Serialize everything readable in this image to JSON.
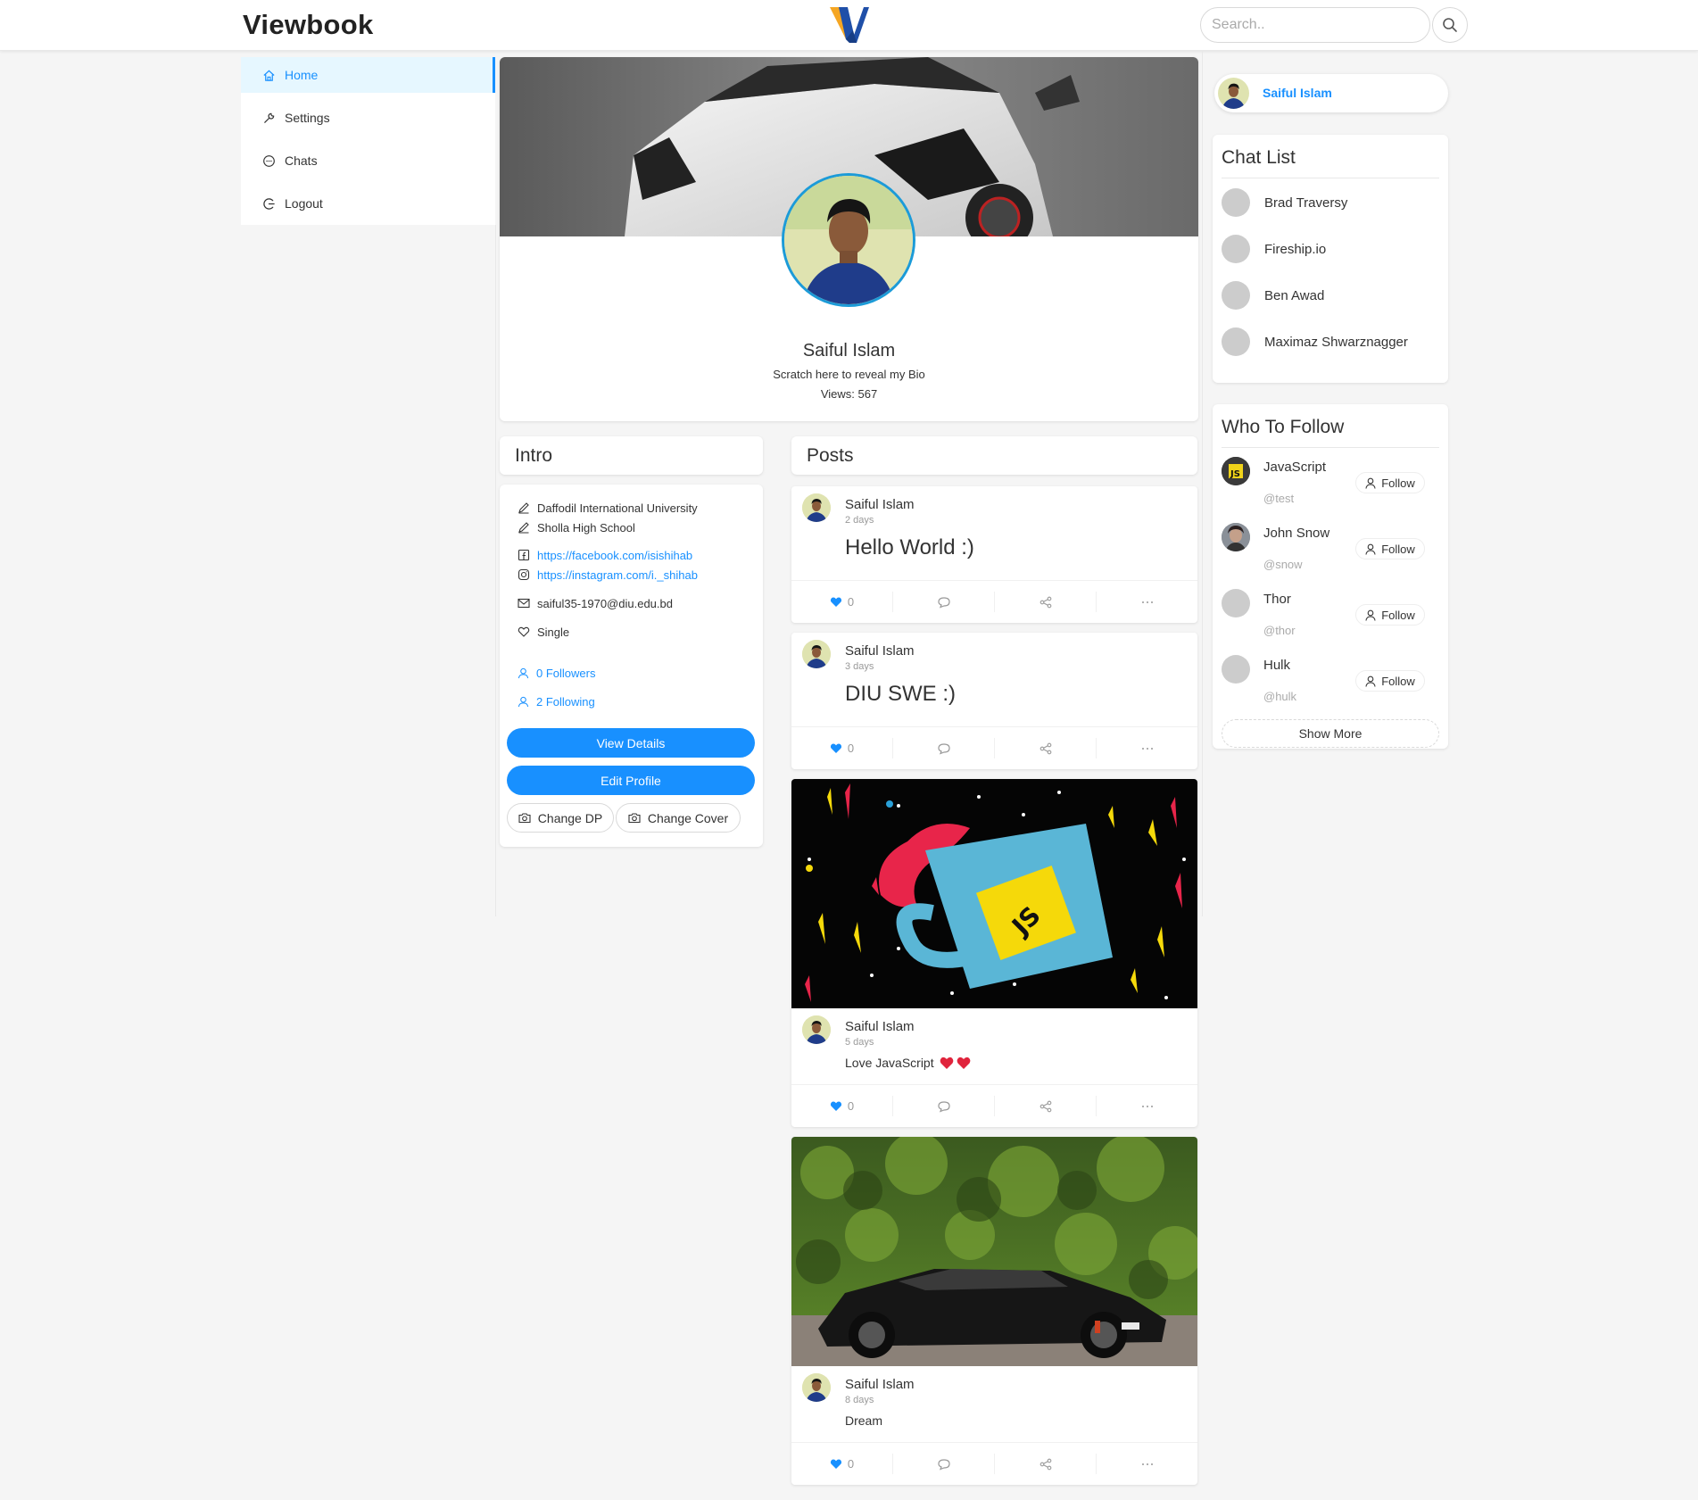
{
  "header": {
    "brand": "Viewbook",
    "search_placeholder": "Search.."
  },
  "nav": {
    "items": [
      {
        "label": "Home",
        "icon": "home-icon",
        "active": true
      },
      {
        "label": "Settings",
        "icon": "wrench-icon"
      },
      {
        "label": "Chats",
        "icon": "message-icon"
      },
      {
        "label": "Logout",
        "icon": "logout-icon"
      }
    ]
  },
  "profile": {
    "name": "Saiful Islam",
    "bio": "Scratch here to reveal my Bio",
    "views": "Views: 567"
  },
  "intro": {
    "title": "Intro",
    "university": "Daffodil International University",
    "school": "Sholla High School",
    "facebook": "https://facebook.com/isishihab",
    "instagram": "https://instagram.com/i._shihab",
    "email": "saiful35-1970@diu.edu.bd",
    "relationship": "Single",
    "followers": "0 Followers",
    "following": "2 Following",
    "view_details": "View Details",
    "edit_profile": "Edit Profile",
    "change_dp": "Change DP",
    "change_cover": "Change Cover"
  },
  "posts": {
    "title": "Posts",
    "items": [
      {
        "author": "Saiful Islam",
        "time": "2 days",
        "text": "Hello World :)",
        "likes": "0"
      },
      {
        "author": "Saiful Islam",
        "time": "3 days",
        "text": "DIU SWE :)",
        "likes": "0"
      },
      {
        "author": "Saiful Islam",
        "time": "5 days",
        "text": "Love JavaScript",
        "likes": "0"
      },
      {
        "author": "Saiful Islam",
        "time": "8 days",
        "text": "Dream",
        "likes": "0"
      }
    ]
  },
  "sidebar": {
    "user_name": "Saiful Islam",
    "chat_list_title": "Chat List",
    "chats": [
      "Brad Traversy",
      "Fireship.io",
      "Ben Awad",
      "Maximaz Shwarznagger"
    ],
    "who_to_follow_title": "Who To Follow",
    "follow": [
      {
        "name": "JavaScript",
        "handle": "@test"
      },
      {
        "name": "John Snow",
        "handle": "@snow"
      },
      {
        "name": "Thor",
        "handle": "@thor"
      },
      {
        "name": "Hulk",
        "handle": "@hulk"
      }
    ],
    "follow_label": "Follow",
    "show_more": "Show More"
  },
  "colors": {
    "accent": "#1890ff",
    "background": "#f5f5f5"
  }
}
